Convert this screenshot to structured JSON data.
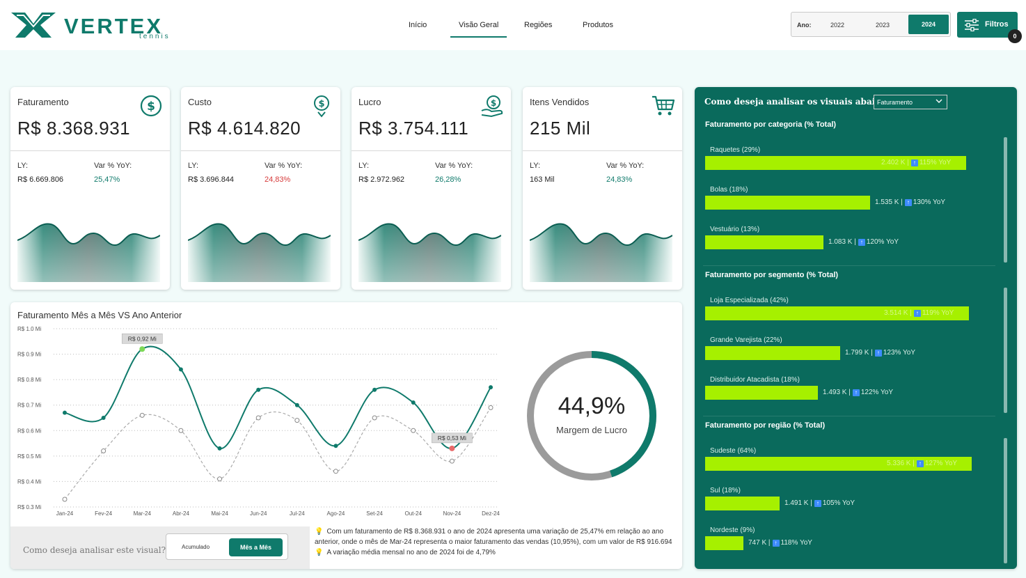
{
  "brand": {
    "name": "VERTEX",
    "sub": "tennis",
    "accent": "#0f7a6b"
  },
  "nav": {
    "items": [
      "Início",
      "Visão Geral",
      "Regiões",
      "Produtos"
    ],
    "active": "Visão Geral"
  },
  "year_filter": {
    "label": "Ano:",
    "options": [
      "2022",
      "2023",
      "2024"
    ],
    "selected": "2024"
  },
  "filters": {
    "label": "Filtros",
    "count": "0"
  },
  "kpis": [
    {
      "title": "Faturamento",
      "value": "R$ 8.368.931",
      "ly_label": "LY:",
      "ly_value": "R$ 6.669.806",
      "var_label": "Var % YoY:",
      "var_value": "25,47%",
      "var_color": "#0f7a6b",
      "icon": "dollar-circle-icon"
    },
    {
      "title": "Custo",
      "value": "R$ 4.614.820",
      "ly_label": "LY:",
      "ly_value": "R$ 3.696.844",
      "var_label": "Var % YoY:",
      "var_value": "24,83%",
      "var_color": "#d63a3a",
      "icon": "dollar-down-icon"
    },
    {
      "title": "Lucro",
      "value": "R$ 3.754.111",
      "ly_label": "LY:",
      "ly_value": "R$ 2.972.962",
      "var_label": "Var % YoY:",
      "var_value": "26,28%",
      "var_color": "#0f7a6b",
      "icon": "hand-coin-icon"
    },
    {
      "title": "Itens Vendidos",
      "value": "215 Mil",
      "ly_label": "LY:",
      "ly_value": "163 Mil",
      "var_label": "Var % YoY:",
      "var_value": "24,83%",
      "var_color": "#0f7a6b",
      "icon": "cart-icon"
    }
  ],
  "main_chart": {
    "title": "Faturamento Mês a Mês VS Ano Anterior",
    "max_label": "R$ 0,92 Mi",
    "min_label": "R$ 0,53 Mi"
  },
  "chart_data": {
    "type": "line",
    "title": "Faturamento Mês a Mês VS Ano Anterior",
    "x": [
      "Jan-24",
      "Fev-24",
      "Mar-24",
      "Abr-24",
      "Mai-24",
      "Jun-24",
      "Jul-24",
      "Ago-24",
      "Set-24",
      "Out-24",
      "Nov-24",
      "Dez-24"
    ],
    "y_ticks": [
      "R$ 0.3 Mi",
      "R$ 0.4 Mi",
      "R$ 0.5 Mi",
      "R$ 0.6 Mi",
      "R$ 0.7 Mi",
      "R$ 0.8 Mi",
      "R$ 0.9 Mi",
      "R$ 1.0 Mi"
    ],
    "ylim": [
      0.3,
      1.0
    ],
    "series": [
      {
        "values": [
          0.67,
          0.65,
          0.92,
          0.84,
          0.53,
          0.76,
          0.7,
          0.54,
          0.76,
          0.71,
          0.53,
          0.77
        ],
        "color": "#0f7a6b",
        "style": "solid"
      },
      {
        "values": [
          0.33,
          0.52,
          0.66,
          0.6,
          0.41,
          0.65,
          0.64,
          0.44,
          0.65,
          0.6,
          0.48,
          0.69
        ],
        "color": "#aaaaaa",
        "style": "dashed"
      }
    ],
    "grid": true
  },
  "gauge": {
    "value": "44,9%",
    "label": "Margem de Lucro",
    "fraction": 0.449
  },
  "analyse": {
    "question": "Como deseja analisar este visual?",
    "options": [
      "Acumulado",
      "Mês a Mês"
    ],
    "selected": "Mês a Mês"
  },
  "insights": [
    "Com um faturamento de R$ 8.368.931 o ano de 2024 apresenta uma variação de 25,47% em relação ao ano anterior, onde o mês de Mar-24 representa o maior faturamento das vendas (10,95%), com um valor de R$ 916.694",
    "A variação média mensal no ano de 2024 foi de 4,79%"
  ],
  "right_panel": {
    "question": "Como deseja analisar os visuais abaixo?",
    "select": "Faturamento",
    "sections": [
      {
        "title": "Faturamento por categoria (% Total)",
        "bars": [
          {
            "label": "Raquetes (29%)",
            "value": "2.402 K",
            "yoy": "115% YoY",
            "fraction": 0.95
          },
          {
            "label": "Bolas (18%)",
            "value": "1.535 K",
            "yoy": "130% YoY",
            "fraction": 0.6
          },
          {
            "label": "Vestuário (13%)",
            "value": "1.083 K",
            "yoy": "120% YoY",
            "fraction": 0.43
          }
        ]
      },
      {
        "title": "Faturamento por segmento (% Total)",
        "bars": [
          {
            "label": "Loja Especializada (42%)",
            "value": "3.514 K",
            "yoy": "119% YoY",
            "fraction": 0.96
          },
          {
            "label": "Grande Varejista (22%)",
            "value": "1.799 K",
            "yoy": "123% YoY",
            "fraction": 0.49
          },
          {
            "label": "Distribuidor Atacadista (18%)",
            "value": "1.493 K",
            "yoy": "122% YoY",
            "fraction": 0.41
          }
        ]
      },
      {
        "title": "Faturamento por região (% Total)",
        "bars": [
          {
            "label": "Sudeste (64%)",
            "value": "5.336 K",
            "yoy": "127% YoY",
            "fraction": 0.97
          },
          {
            "label": "Sul (18%)",
            "value": "1.491 K",
            "yoy": "105% YoY",
            "fraction": 0.27
          },
          {
            "label": "Nordeste (9%)",
            "value": "747 K",
            "yoy": "118% YoY",
            "fraction": 0.14
          }
        ]
      }
    ]
  }
}
